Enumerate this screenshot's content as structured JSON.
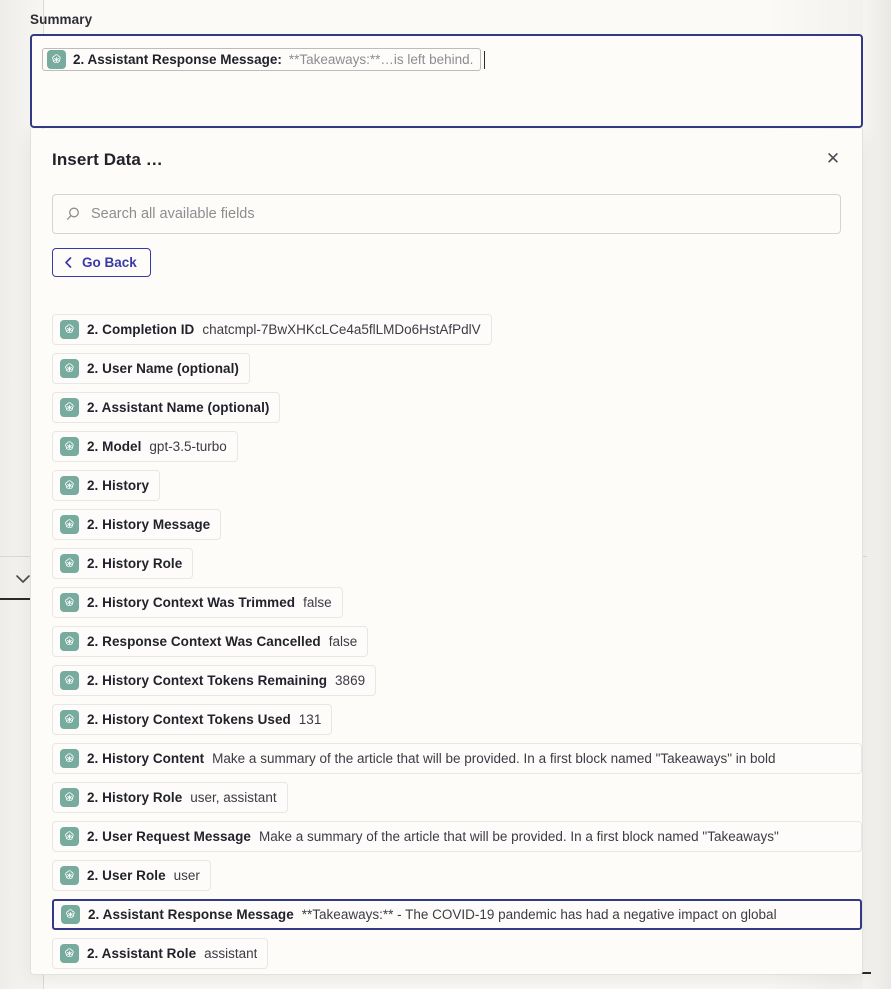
{
  "colors": {
    "accent_navy": "#333a85",
    "link_indigo": "#3a3aa6",
    "gpt_green": "#77ab9d",
    "page_bg": "#fbfaf6",
    "chip_border": "#e8e7e3"
  },
  "summary": {
    "label": "Summary",
    "token": {
      "icon": "chatgpt-icon",
      "label": "2. Assistant Response Message:",
      "value": "**Takeaways:**…is left behind."
    }
  },
  "modal": {
    "title": "Insert Data …",
    "close_label": "✕",
    "search": {
      "placeholder": "Search all available fields",
      "value": "",
      "icon": "search-icon"
    },
    "go_back_label": "Go Back",
    "go_back_icon": "chevron-left-icon",
    "fields": [
      {
        "icon": "chatgpt-icon",
        "name": "2. Completion ID",
        "value": "chatcmpl-7BwXHKcLCe4a5flLMDo6HstAfPdlV",
        "selected": false,
        "wide": false
      },
      {
        "icon": "chatgpt-icon",
        "name": "2. User Name (optional)",
        "value": "",
        "selected": false,
        "wide": false
      },
      {
        "icon": "chatgpt-icon",
        "name": "2. Assistant Name (optional)",
        "value": "",
        "selected": false,
        "wide": false
      },
      {
        "icon": "chatgpt-icon",
        "name": "2. Model",
        "value": "gpt-3.5-turbo",
        "selected": false,
        "wide": false
      },
      {
        "icon": "chatgpt-icon",
        "name": "2. History",
        "value": "",
        "selected": false,
        "wide": false
      },
      {
        "icon": "chatgpt-icon",
        "name": "2. History Message",
        "value": "",
        "selected": false,
        "wide": false
      },
      {
        "icon": "chatgpt-icon",
        "name": "2. History Role",
        "value": "",
        "selected": false,
        "wide": false
      },
      {
        "icon": "chatgpt-icon",
        "name": "2. History Context Was Trimmed",
        "value": "false",
        "selected": false,
        "wide": false
      },
      {
        "icon": "chatgpt-icon",
        "name": "2. Response Context Was Cancelled",
        "value": "false",
        "selected": false,
        "wide": false
      },
      {
        "icon": "chatgpt-icon",
        "name": "2. History Context Tokens Remaining",
        "value": "3869",
        "selected": false,
        "wide": false
      },
      {
        "icon": "chatgpt-icon",
        "name": "2. History Context Tokens Used",
        "value": "131",
        "selected": false,
        "wide": false
      },
      {
        "icon": "chatgpt-icon",
        "name": "2. History Content",
        "value": "Make a summary of the article that will be provided. In a first block named \"Takeaways\" in bold",
        "selected": false,
        "wide": true
      },
      {
        "icon": "chatgpt-icon",
        "name": "2. History Role",
        "value": "user, assistant",
        "selected": false,
        "wide": false
      },
      {
        "icon": "chatgpt-icon",
        "name": "2. User Request Message",
        "value": "Make a summary of the article that will be provided. In a first block named \"Takeaways\"",
        "selected": false,
        "wide": true
      },
      {
        "icon": "chatgpt-icon",
        "name": "2. User Role",
        "value": "user",
        "selected": false,
        "wide": false
      },
      {
        "icon": "chatgpt-icon",
        "name": "2. Assistant Response Message",
        "value": "**Takeaways:** - The COVID-19 pandemic has had a negative impact on global",
        "selected": true,
        "wide": true
      },
      {
        "icon": "chatgpt-icon",
        "name": "2. Assistant Role",
        "value": "assistant",
        "selected": false,
        "wide": false
      }
    ]
  },
  "background": {
    "collapse_icon": "chevron-down-icon"
  }
}
